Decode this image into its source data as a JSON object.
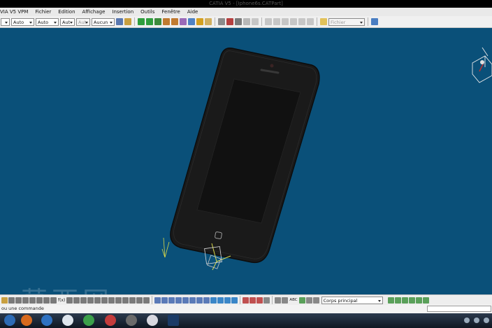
{
  "window": {
    "title": "CATIA V5 - [Iphone6s.CATPart]"
  },
  "menu": [
    "VIA V5 VPM",
    "Fichier",
    "Edition",
    "Affichage",
    "Insertion",
    "Outils",
    "Fenêtre",
    "Aide"
  ],
  "toolbar": {
    "combos": [
      "Auto",
      "Auto",
      "Aut",
      "Aut",
      "Aucun"
    ],
    "file_combo": "Fichier"
  },
  "bottom_toolbar": {
    "body_combo": "Corps principal",
    "labels": [
      "f(x)",
      "ABC"
    ]
  },
  "status": {
    "text": "ou une commande"
  },
  "watermark": "莫西网",
  "colors": {
    "background": "#0a5079",
    "phone_body": "#1a1a1a",
    "axis": "#d8d84a"
  }
}
